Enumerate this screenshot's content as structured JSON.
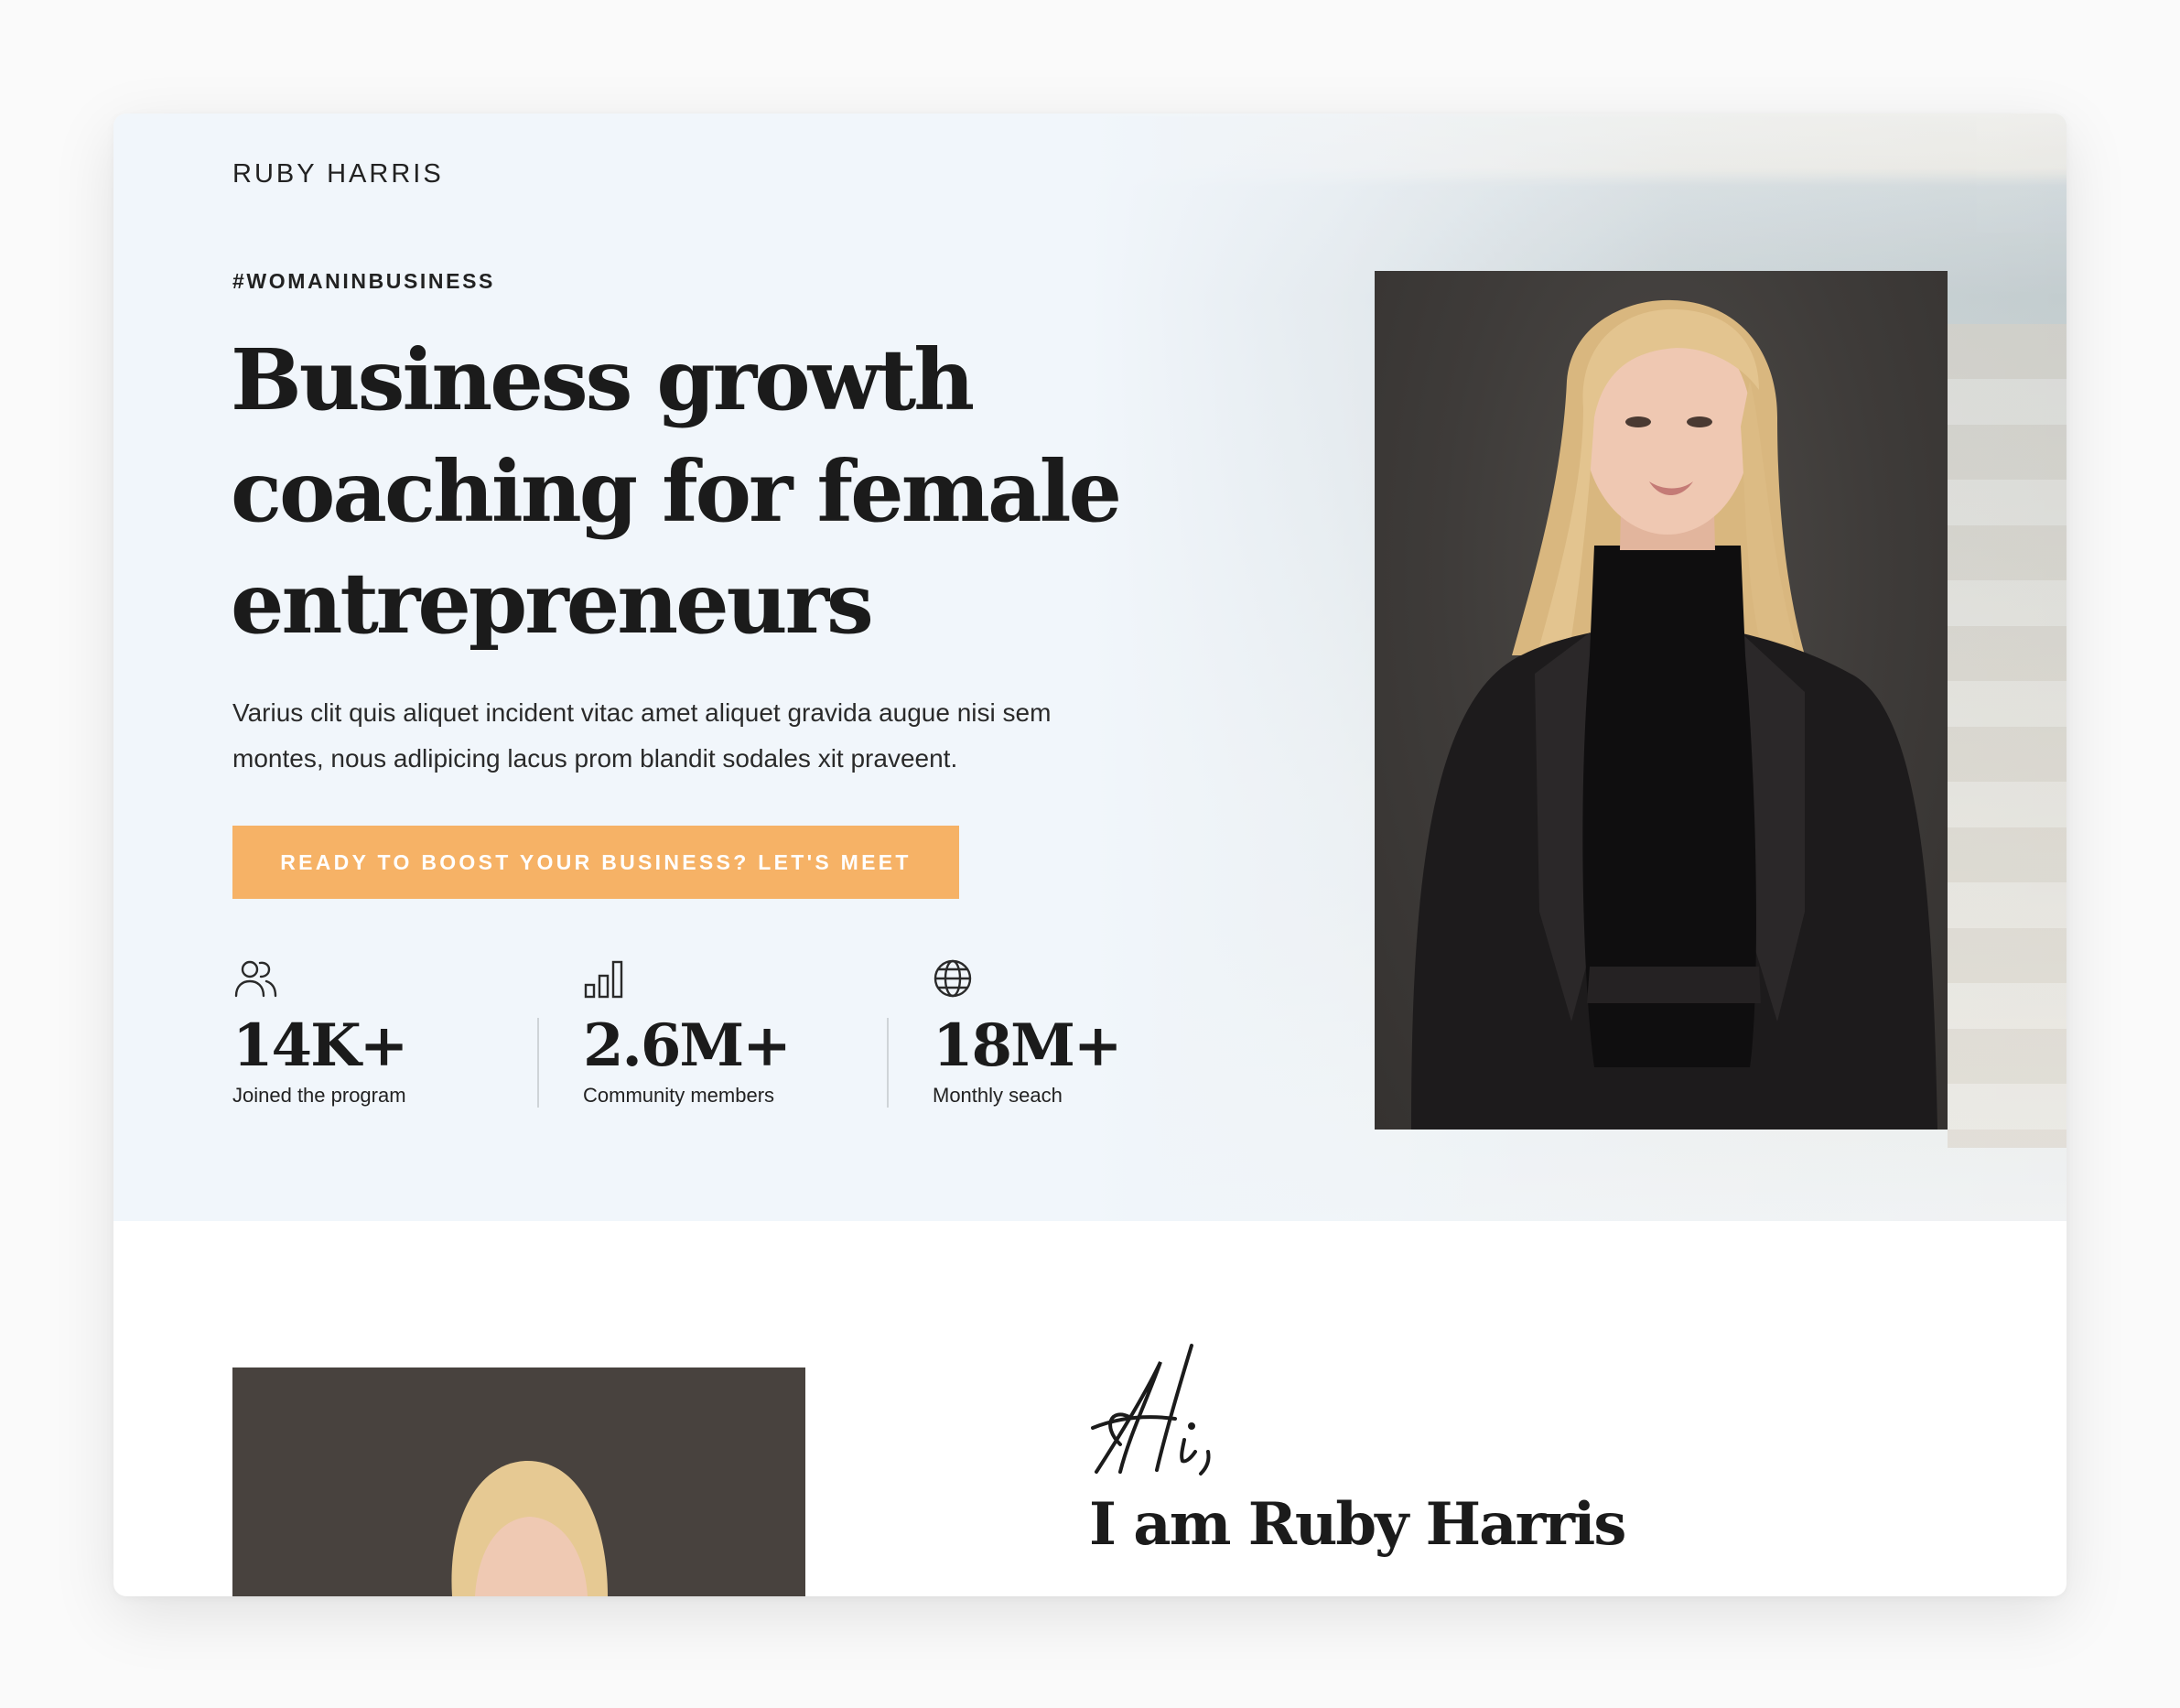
{
  "header": {
    "brand": "RUBY HARRIS"
  },
  "hero": {
    "tag": "#WOMANINBUSINESS",
    "headline": "Business growth coaching for female entrepreneurs",
    "lead": "Varius clit quis aliquet incident vitac amet aliquet gravida augue nisi sem montes, nous adlipicing lacus prom blandit sodales xit praveent.",
    "cta_label": "READY TO BOOST YOUR BUSINESS? LET'S MEET",
    "cta_color": "#f6b266"
  },
  "stats": [
    {
      "icon": "users-icon",
      "value": "14K+",
      "label": "Joined the program"
    },
    {
      "icon": "bar-chart-icon",
      "value": "2.6M+",
      "label": "Community members"
    },
    {
      "icon": "globe-icon",
      "value": "18M+",
      "label": "Monthly seach"
    }
  ],
  "about": {
    "signature": "Hi,",
    "title": "I am Ruby Harris"
  }
}
